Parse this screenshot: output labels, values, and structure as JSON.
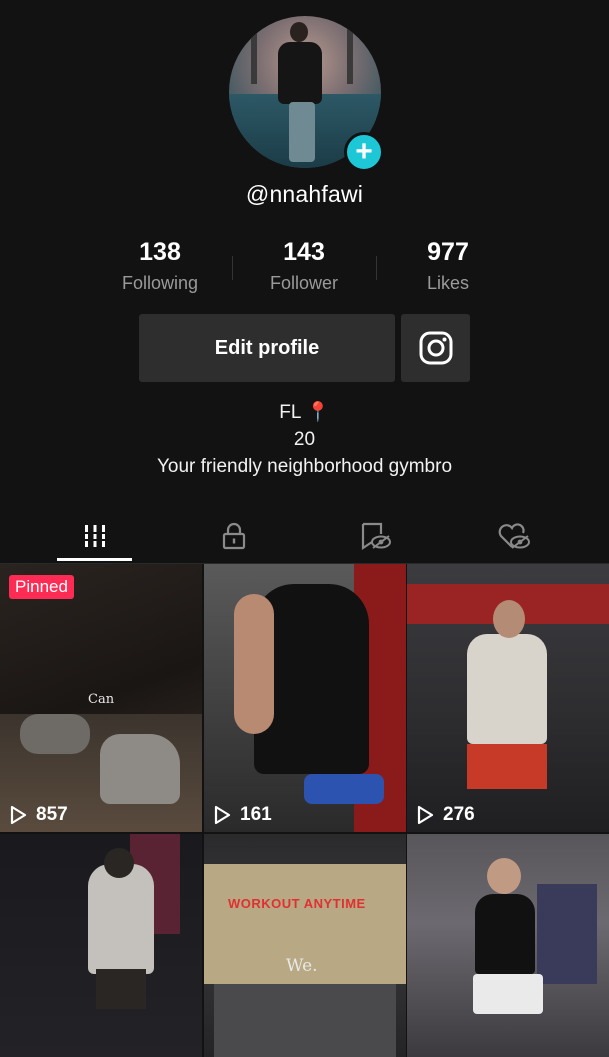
{
  "profile": {
    "username": "@nnahfawi",
    "add_symbol": "+"
  },
  "stats": {
    "following": {
      "count": "138",
      "label": "Following"
    },
    "followers": {
      "count": "143",
      "label": "Follower"
    },
    "likes": {
      "count": "977",
      "label": "Likes"
    }
  },
  "actions": {
    "edit_profile_label": "Edit profile",
    "instagram_icon": "instagram-icon"
  },
  "bio": {
    "line1": "FL 📍",
    "line2": "20",
    "line3": "Your friendly neighborhood gymbro"
  },
  "tabs": [
    {
      "icon": "videos-grid-icon",
      "active": true
    },
    {
      "icon": "lock-icon",
      "active": false
    },
    {
      "icon": "bookmark-hidden-icon",
      "active": false
    },
    {
      "icon": "heart-hidden-icon",
      "active": false
    }
  ],
  "videos": [
    {
      "views": "857",
      "pinned_label": "Pinned",
      "caption": "Can"
    },
    {
      "views": "161"
    },
    {
      "views": "276"
    },
    {
      "views": ""
    },
    {
      "views": "",
      "caption": "We.",
      "sign": "WORKOUT ANYTIME"
    },
    {
      "views": ""
    }
  ],
  "colors": {
    "background": "#121212",
    "accent_cyan": "#1ec7d6",
    "pinned_red": "#fe2c55",
    "button_bg": "#2e2e2e"
  }
}
